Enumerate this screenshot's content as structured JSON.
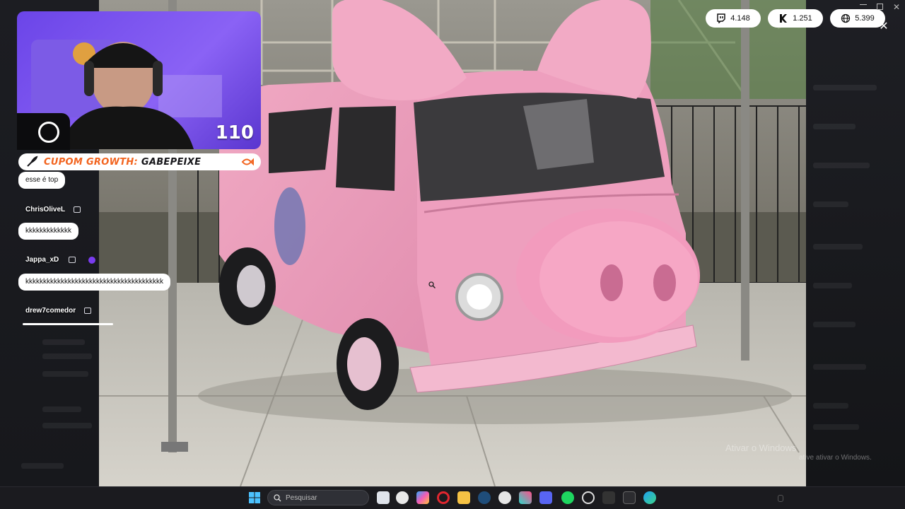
{
  "overlay": {
    "coupon": {
      "label_prefix": "CUPOM GROWTH:",
      "label_code": "GABEPEIXE"
    },
    "webcam": {
      "counter": "110"
    }
  },
  "chat": {
    "messages": [
      {
        "text": "esse é top"
      },
      {
        "user": "ChrisOliveL",
        "text": "kkkkkkkkkkkkk"
      },
      {
        "user": "Jappa_xD",
        "text": "kkkkkkkkkkkkkkkkkkkkkkkkkkkkkkkkkkkkkkk"
      },
      {
        "user": "drew7comedor"
      }
    ]
  },
  "stats": [
    {
      "icon": "twitch-icon",
      "value": "4.148"
    },
    {
      "icon": "kick-icon",
      "value": "1.251"
    },
    {
      "icon": "globe-icon",
      "value": "5.399"
    }
  ],
  "watermark": {
    "line1": "Ativar o Windows",
    "line2": "ative ativar o Windows."
  },
  "taskbar": {
    "search_placeholder": "Pesquisar",
    "apps": [
      "start-icon",
      "file-icon",
      "emoji-icon",
      "copilot-icon",
      "opera-icon",
      "folder-icon",
      "steam-icon",
      "emoji2-icon",
      "capcut-icon",
      "discord-icon",
      "spotify-icon",
      "obs-icon",
      "app-icon",
      "terminal-icon",
      "edge-icon"
    ]
  }
}
